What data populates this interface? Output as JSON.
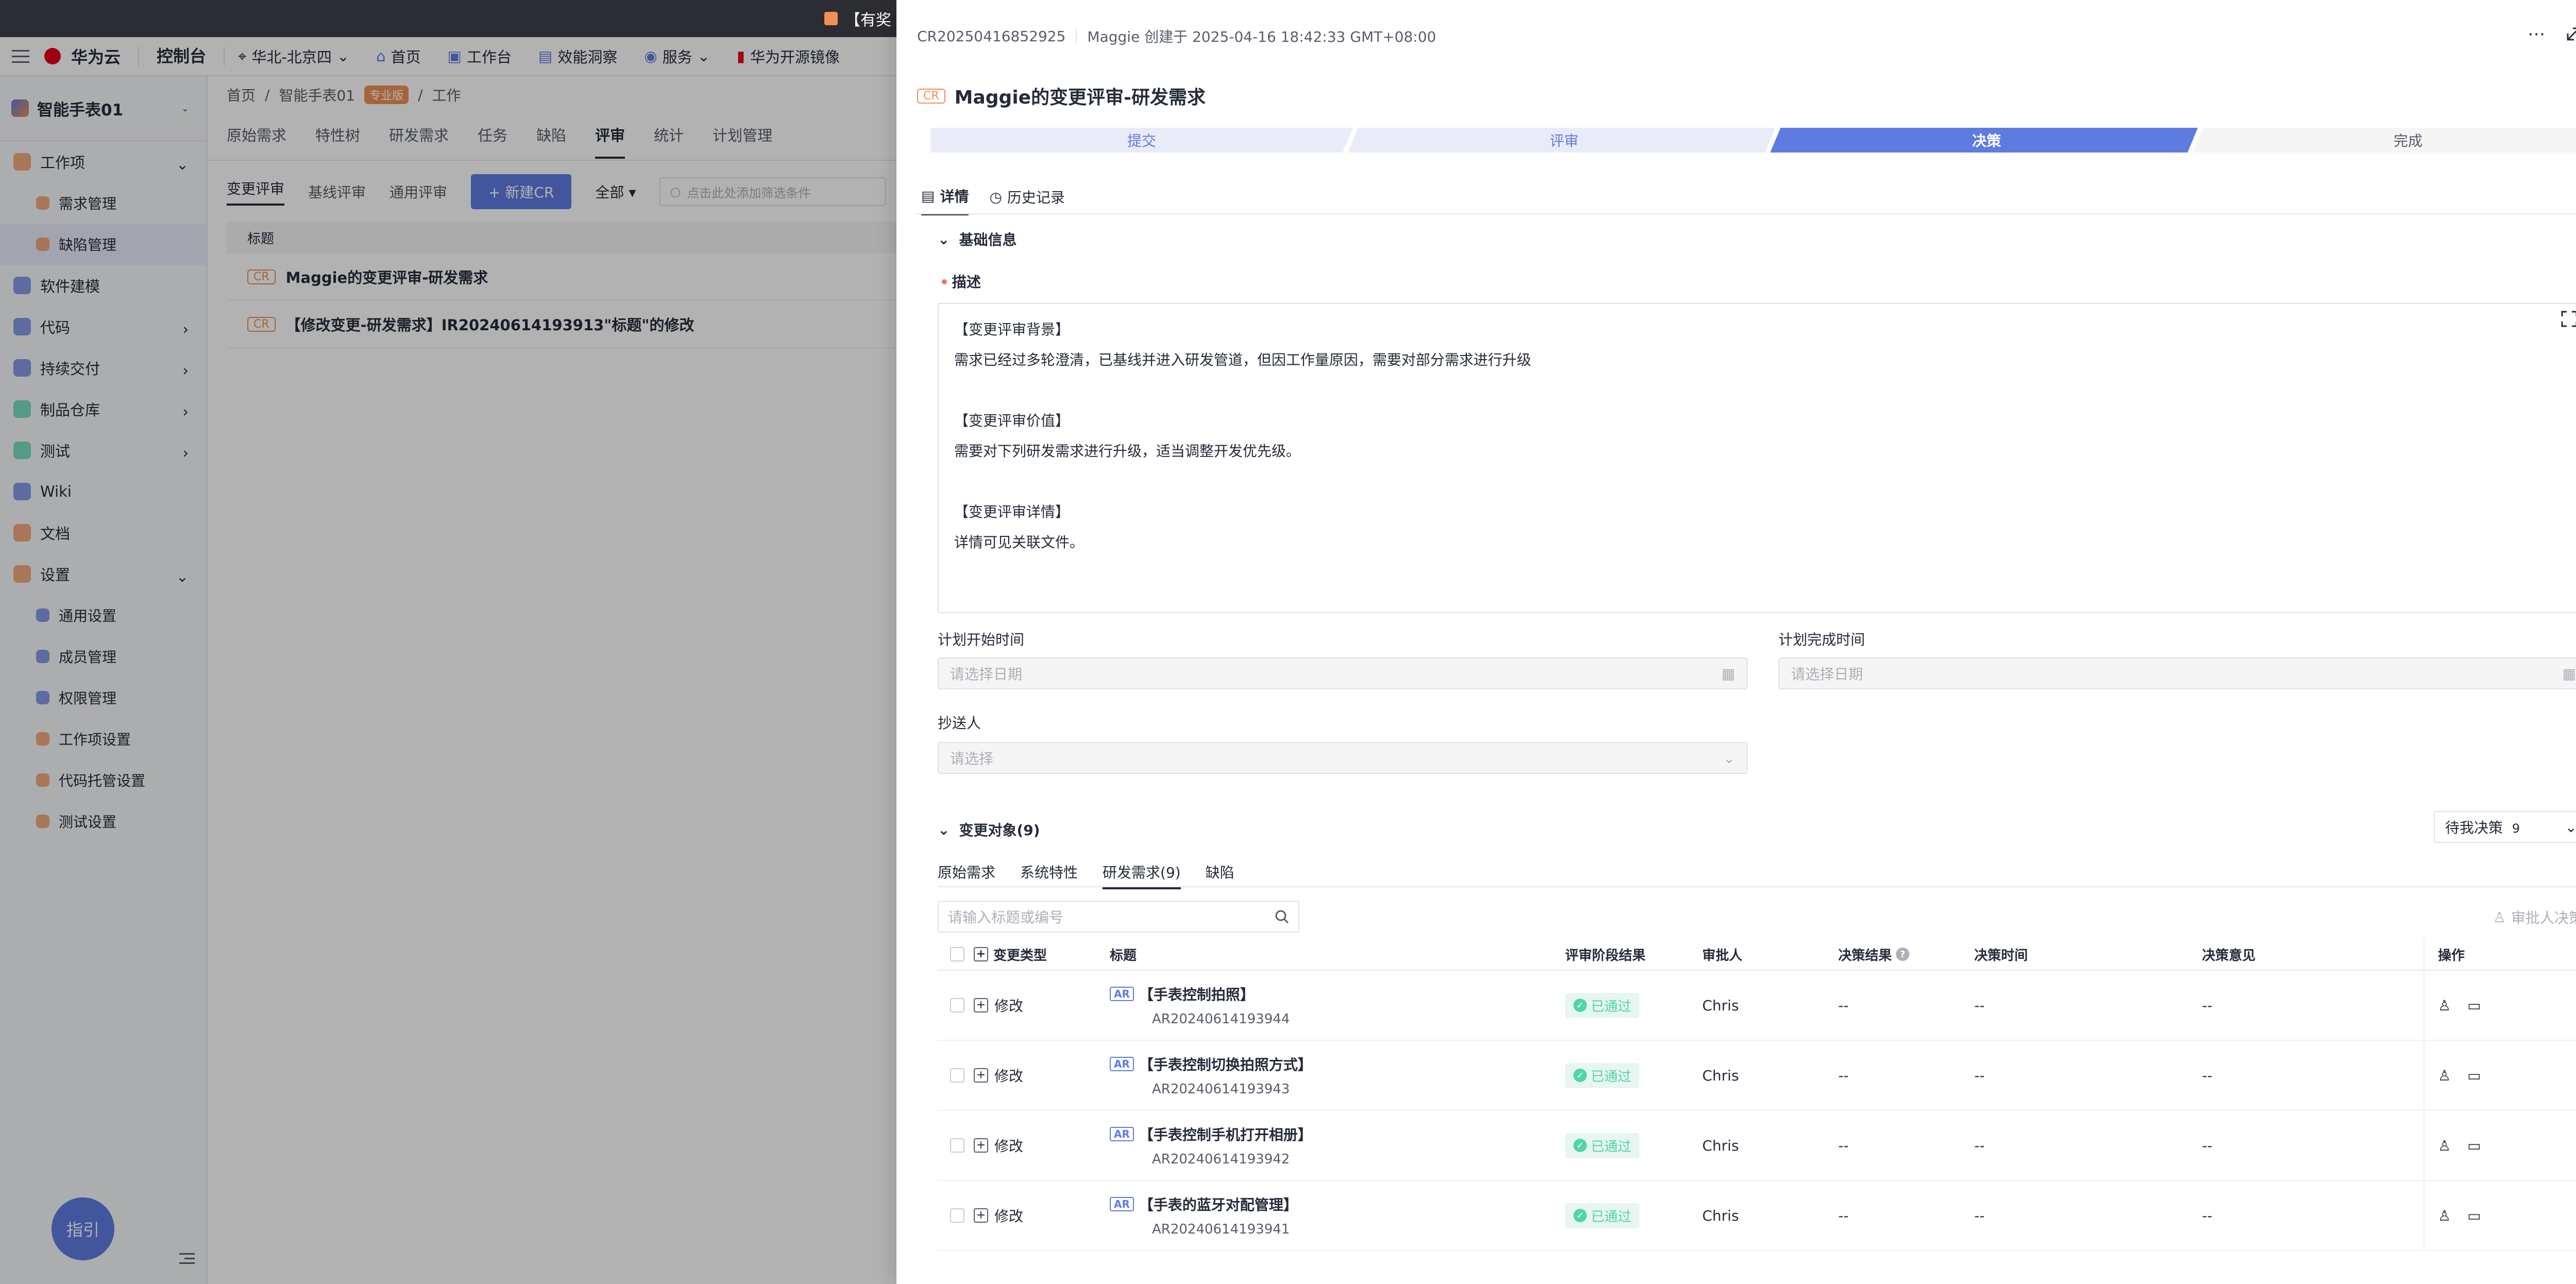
{
  "topbar": {
    "notice": "【有奖"
  },
  "header": {
    "logo_text": "华为云",
    "console": "控制台",
    "region": "华北-北京四",
    "nav": [
      "首页",
      "工作台",
      "效能洞察",
      "服务",
      "华为开源镜像"
    ]
  },
  "sidebar": {
    "project": "智能手表01",
    "items": [
      {
        "label": "工作项",
        "chev": "down"
      },
      {
        "label": "需求管理",
        "sub": true
      },
      {
        "label": "缺陷管理",
        "sub": true
      },
      {
        "label": "软件建模"
      },
      {
        "label": "代码",
        "chev": "right"
      },
      {
        "label": "持续交付",
        "chev": "right"
      },
      {
        "label": "制品仓库",
        "chev": "right"
      },
      {
        "label": "测试",
        "chev": "right"
      },
      {
        "label": "Wiki"
      },
      {
        "label": "文档"
      },
      {
        "label": "设置",
        "chev": "down"
      },
      {
        "label": "通用设置",
        "sub": true
      },
      {
        "label": "成员管理",
        "sub": true
      },
      {
        "label": "权限管理",
        "sub": true
      },
      {
        "label": "工作项设置",
        "sub": true
      },
      {
        "label": "代码托管设置",
        "sub": true
      },
      {
        "label": "测试设置",
        "sub": true
      }
    ],
    "guide": "指引"
  },
  "mid": {
    "breadcrumb": [
      "首页",
      "/",
      "智能手表01",
      "/",
      "工作"
    ],
    "badge": "专业版",
    "tabs1": [
      "原始需求",
      "特性树",
      "研发需求",
      "任务",
      "缺陷",
      "评审",
      "统计",
      "计划管理"
    ],
    "tabs2": [
      "变更评审",
      "基线评审",
      "通用评审"
    ],
    "new_btn": "+ 新建CR",
    "filter": "全部",
    "search_placeholder": "点击此处添加筛选条件",
    "col_title": "标题",
    "rows": [
      {
        "badge": "CR",
        "title": "Maggie的变更评审-研发需求"
      },
      {
        "badge": "CR",
        "title": "【修改变更-研发需求】IR20240614193913\"标题\"的修改"
      }
    ]
  },
  "drawer": {
    "id": "CR20250416852925",
    "creator": "Maggie 创建于 2025-04-16 18:42:33 GMT+08:00",
    "badge": "CR",
    "title": "Maggie的变更评审-研发需求",
    "steps": [
      "提交",
      "评审",
      "决策",
      "完成"
    ],
    "tabs": [
      "详情",
      "历史记录"
    ],
    "basic": "基础信息",
    "desc_label": "描述",
    "desc_lines": [
      "【变更评审背景】",
      "需求已经过多轮澄清，已基线并进入研发管道，但因工作量原因，需要对部分需求进行升级",
      "",
      "【变更评审价值】",
      "需要对下列研发需求进行升级，适当调整开发优先级。",
      "",
      "【变更评审详情】",
      "详情可见关联文件。"
    ],
    "plan_start_label": "计划开始时间",
    "plan_end_label": "计划完成时间",
    "date_placeholder": "请选择日期",
    "cc_label": "抄送人",
    "cc_placeholder": "请选择",
    "objects_title": "变更对象(9)",
    "pending": {
      "label": "待我决策",
      "count": "9"
    },
    "subtabs": [
      "原始需求",
      "系统特性",
      "研发需求(9)",
      "缺陷"
    ],
    "search_placeholder": "请输入标题或编号",
    "approver_btn": "审批人决策",
    "columns": [
      "变更类型",
      "标题",
      "评审阶段结果",
      "审批人",
      "决策结果",
      "决策时间",
      "决策意见",
      "操作"
    ],
    "rows": [
      {
        "type": "修改",
        "title": "【手表控制拍照】",
        "no": "AR20240614193944",
        "stage": "已通过",
        "approver": "Chris",
        "result": "--",
        "time": "--",
        "opinion": "--"
      },
      {
        "type": "修改",
        "title": "【手表控制切换拍照方式】",
        "no": "AR20240614193943",
        "stage": "已通过",
        "approver": "Chris",
        "result": "--",
        "time": "--",
        "opinion": "--"
      },
      {
        "type": "修改",
        "title": "【手表控制手机打开相册】",
        "no": "AR20240614193942",
        "stage": "已通过",
        "approver": "Chris",
        "result": "--",
        "time": "--",
        "opinion": "--"
      },
      {
        "type": "修改",
        "title": "【手表的蓝牙对配管理】",
        "no": "AR20240614193941",
        "stage": "已通过",
        "approver": "Chris",
        "result": "--",
        "time": "--",
        "opinion": "--"
      }
    ],
    "ar_badge": "AR"
  },
  "colors": {
    "primary": "#5e7ce0",
    "cr_orange": "#f09054",
    "pass_green": "#50d4ab"
  }
}
